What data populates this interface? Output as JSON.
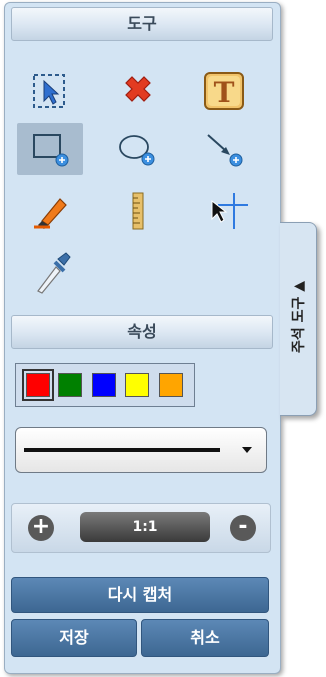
{
  "tools_header": "도구",
  "tools": [
    {
      "name": "select-area",
      "icon": "dashed-rect-arrow-icon"
    },
    {
      "name": "delete",
      "icon": "red-x-icon"
    },
    {
      "name": "text",
      "icon": "text-t-icon"
    },
    {
      "name": "rectangle",
      "icon": "rectangle-plus-icon",
      "selected": true
    },
    {
      "name": "ellipse",
      "icon": "ellipse-plus-icon"
    },
    {
      "name": "arrow",
      "icon": "arrow-plus-icon"
    },
    {
      "name": "highlighter",
      "icon": "highlighter-icon"
    },
    {
      "name": "ruler",
      "icon": "ruler-icon"
    },
    {
      "name": "crosshair",
      "icon": "crosshair-cursor-icon"
    },
    {
      "name": "eyedropper",
      "icon": "eyedropper-icon"
    }
  ],
  "properties_header": "속성",
  "colors": [
    "#ff0000",
    "#008000",
    "#0000ff",
    "#ffff00",
    "#ffa500"
  ],
  "selected_color_index": 0,
  "line_style": "solid-thick",
  "zoom": {
    "plus": "+",
    "label": "1:1",
    "minus": "-"
  },
  "buttons": {
    "recapture": "다시 캡처",
    "save": "저장",
    "cancel": "취소"
  },
  "side_tab": {
    "label": "주석 도구 ▲"
  }
}
